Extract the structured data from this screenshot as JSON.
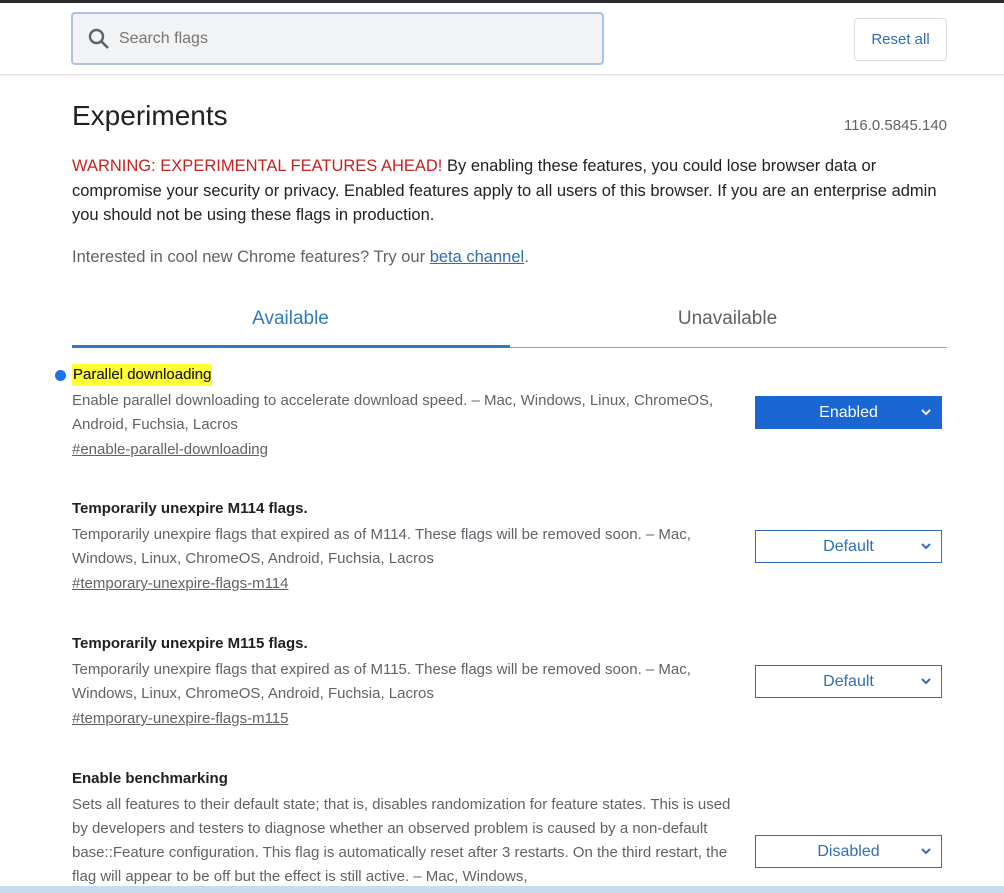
{
  "header": {
    "search_placeholder": "Search flags",
    "reset_label": "Reset all"
  },
  "page": {
    "title": "Experiments",
    "version": "116.0.5845.140",
    "warning_prefix": "WARNING: EXPERIMENTAL FEATURES AHEAD!",
    "warning_text": " By enabling these features, you could lose browser data or compromise your security or privacy. Enabled features apply to all users of this browser. If you are an enterprise admin you should not be using these flags in production.",
    "beta_text": "Interested in cool new Chrome features? Try our ",
    "beta_link": "beta channel",
    "beta_suffix": "."
  },
  "tabs": [
    {
      "label": "Available",
      "active": true
    },
    {
      "label": "Unavailable",
      "active": false
    }
  ],
  "flags": [
    {
      "title": "Parallel downloading",
      "description": "Enable parallel downloading to accelerate download speed. – Mac, Windows, Linux, ChromeOS, Android, Fuchsia, Lacros",
      "link": "#enable-parallel-downloading",
      "value": "Enabled",
      "modified": true
    },
    {
      "title": "Temporarily unexpire M114 flags.",
      "description": "Temporarily unexpire flags that expired as of M114. These flags will be removed soon. – Mac, Windows, Linux, ChromeOS, Android, Fuchsia, Lacros",
      "link": "#temporary-unexpire-flags-m114",
      "value": "Default"
    },
    {
      "title": "Temporarily unexpire M115 flags.",
      "description": "Temporarily unexpire flags that expired as of M115. These flags will be removed soon. – Mac, Windows, Linux, ChromeOS, Android, Fuchsia, Lacros",
      "link": "#temporary-unexpire-flags-m115",
      "value": "Default"
    },
    {
      "title": "Enable benchmarking",
      "description": "Sets all features to their default state; that is, disables randomization for feature states. This is used by developers and testers to diagnose whether an observed problem is caused by a non-default base::Feature configuration. This flag is automatically reset after 3 restarts. On the third restart, the flag will appear to be off but the effect is still active. – Mac, Windows,",
      "value": "Disabled"
    }
  ],
  "colors": {
    "accent": "#1a73e8",
    "warning": "#c5221f",
    "highlight": "#ffff33"
  }
}
